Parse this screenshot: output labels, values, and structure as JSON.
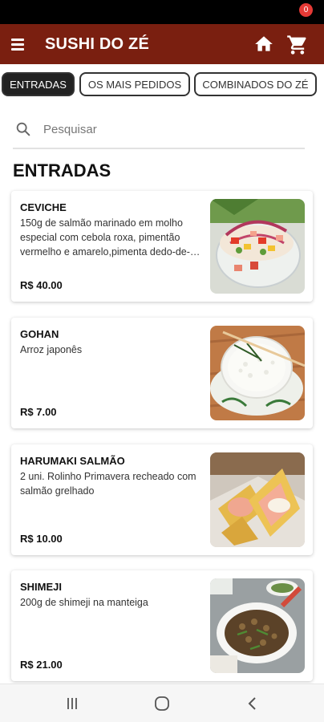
{
  "header": {
    "title": "SUSHI DO ZÉ",
    "cart_count": "0"
  },
  "tabs": [
    {
      "label": "ENTRADAS"
    },
    {
      "label": "OS MAIS PEDIDOS"
    },
    {
      "label": "COMBINADOS DO ZÉ"
    }
  ],
  "search": {
    "placeholder": "Pesquisar"
  },
  "section": {
    "title": "ENTRADAS"
  },
  "items": [
    {
      "name": "CEVICHE",
      "description": "150g de salmão marinado em molho especial com cebola roxa, pimentão vermelho e amarelo,pimenta dedo-de-moça",
      "price": "R$ 40.00"
    },
    {
      "name": "GOHAN",
      "description": "Arroz japonês",
      "price": "R$ 7.00"
    },
    {
      "name": "HARUMAKI SALMÃO",
      "description": "2 uni. Rolinho Primavera recheado com salmão grelhado",
      "price": "R$ 10.00"
    },
    {
      "name": "SHIMEJI",
      "description": "200g de shimeji na manteiga",
      "price": "R$ 21.00"
    }
  ],
  "icons": {
    "menu": "menu-icon",
    "home": "home-icon",
    "cart": "cart-icon",
    "search": "search-icon",
    "nav_recents": "recents-icon",
    "nav_home": "circle-home-icon",
    "nav_back": "back-icon"
  },
  "colors": {
    "app_bar": "#7a1f10",
    "badge": "#e53935",
    "active_tab": "#222222"
  }
}
